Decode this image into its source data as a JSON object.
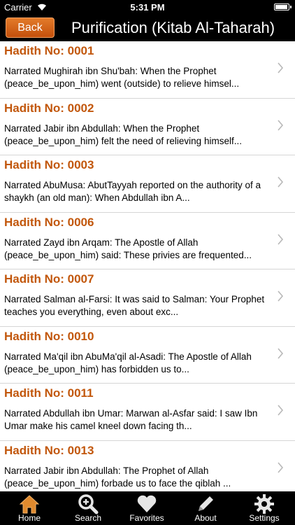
{
  "status_bar": {
    "carrier": "Carrier",
    "time": "5:31 PM",
    "battery_level": 0.95
  },
  "nav": {
    "back_label": "Back",
    "title": "Purification (Kitab Al-Taharah)"
  },
  "hadiths": [
    {
      "number": "Hadith No: 0001",
      "text": "Narrated Mughirah ibn Shu'bah: When the Prophet (peace_be_upon_him) went (outside) to relieve himsel..."
    },
    {
      "number": "Hadith No: 0002",
      "text": "Narrated Jabir ibn Abdullah: When the Prophet (peace_be_upon_him) felt the need of relieving himself..."
    },
    {
      "number": "Hadith No: 0003",
      "text": "Narrated AbuMusa: AbutTayyah reported on the authority of a shaykh (an old man): When Abdullah ibn A..."
    },
    {
      "number": "Hadith No: 0006",
      "text": "Narrated Zayd ibn Arqam: The Apostle of Allah (peace_be_upon_him) said: These privies are frequented..."
    },
    {
      "number": "Hadith No: 0007",
      "text": "Narrated Salman al-Farsi: It was said to Salman: Your Prophet teaches you everything, even about exc..."
    },
    {
      "number": "Hadith No: 0010",
      "text": "Narrated Ma'qil ibn AbuMa'qil al-Asadi: The Apostle of Allah (peace_be_upon_him) has forbidden us to..."
    },
    {
      "number": "Hadith No: 0011",
      "text": "Narrated Abdullah ibn Umar: Marwan al-Asfar said: I saw Ibn Umar make his camel kneel down facing th..."
    },
    {
      "number": "Hadith No: 0013",
      "text": "Narrated Jabir ibn Abdullah: The Prophet of Allah (peace_be_upon_him) forbade us to face the qiblah ..."
    }
  ],
  "tabs": [
    {
      "label": "Home",
      "icon": "home-icon"
    },
    {
      "label": "Search",
      "icon": "search-icon"
    },
    {
      "label": "Favorites",
      "icon": "heart-icon"
    },
    {
      "label": "About",
      "icon": "pencil-icon"
    },
    {
      "label": "Settings",
      "icon": "gear-icon"
    }
  ],
  "colors": {
    "accent": "#c2570c",
    "button": "#d9631a",
    "bar": "#000000",
    "tab_icon": "#e6e6e6",
    "home_icon": "#e08a2e"
  }
}
